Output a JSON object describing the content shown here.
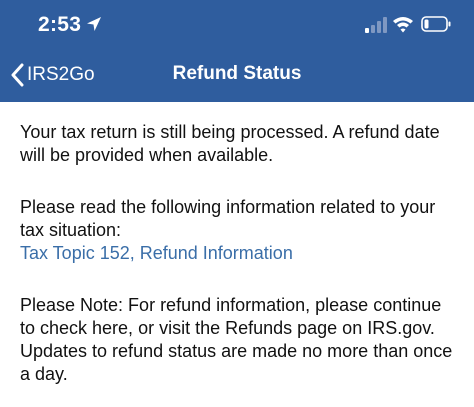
{
  "status_bar": {
    "time": "2:53",
    "location_icon": "location-arrow-icon",
    "signal_icon": "cellular-signal-icon",
    "wifi_icon": "wifi-icon",
    "battery_icon": "battery-low-icon"
  },
  "nav": {
    "back_label": "IRS2Go",
    "title": "Refund Status"
  },
  "colors": {
    "header_bg": "#2f5d9e",
    "link": "#3a6ea8",
    "text": "#111111"
  },
  "content": {
    "paragraph1": "Your tax return is still being processed.  A refund date will be provided when available.",
    "paragraph2": "Please read the following information related to your tax situation:",
    "link_text": "Tax Topic 152, Refund Information",
    "paragraph3": "Please Note: For refund information, please continue to check here, or visit the Refunds page on IRS.gov. Updates to refund status are made no more than once a day."
  }
}
